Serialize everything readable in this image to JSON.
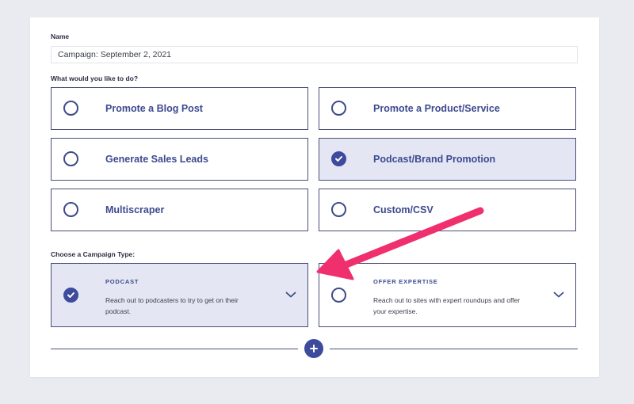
{
  "form": {
    "name_label": "Name",
    "name_value": "Campaign: September 2, 2021",
    "goal_label": "What would you like to do?",
    "type_label": "Choose a Campaign Type:"
  },
  "goals": [
    {
      "label": "Promote a Blog Post",
      "selected": false
    },
    {
      "label": "Promote a Product/Service",
      "selected": false
    },
    {
      "label": "Generate Sales Leads",
      "selected": false
    },
    {
      "label": "Podcast/Brand Promotion",
      "selected": true
    },
    {
      "label": "Multiscraper",
      "selected": false
    },
    {
      "label": "Custom/CSV",
      "selected": false
    }
  ],
  "campaign_types": [
    {
      "title": "PODCAST",
      "description": "Reach out to podcasters to try to get on their podcast.",
      "selected": true
    },
    {
      "title": "OFFER EXPERTISE",
      "description": "Reach out to sites with expert roundups and offer your expertise.",
      "selected": false
    }
  ],
  "icons": {
    "check": "check-icon",
    "chevron": "chevron-down-icon",
    "add": "plus-icon",
    "arrow": "annotation-arrow"
  },
  "colors": {
    "accent": "#3e4a9c",
    "selected_bg": "#e4e7f3",
    "border": "#4a4f7c",
    "annotation": "#f0306e",
    "page_bg": "#eaebf0"
  }
}
